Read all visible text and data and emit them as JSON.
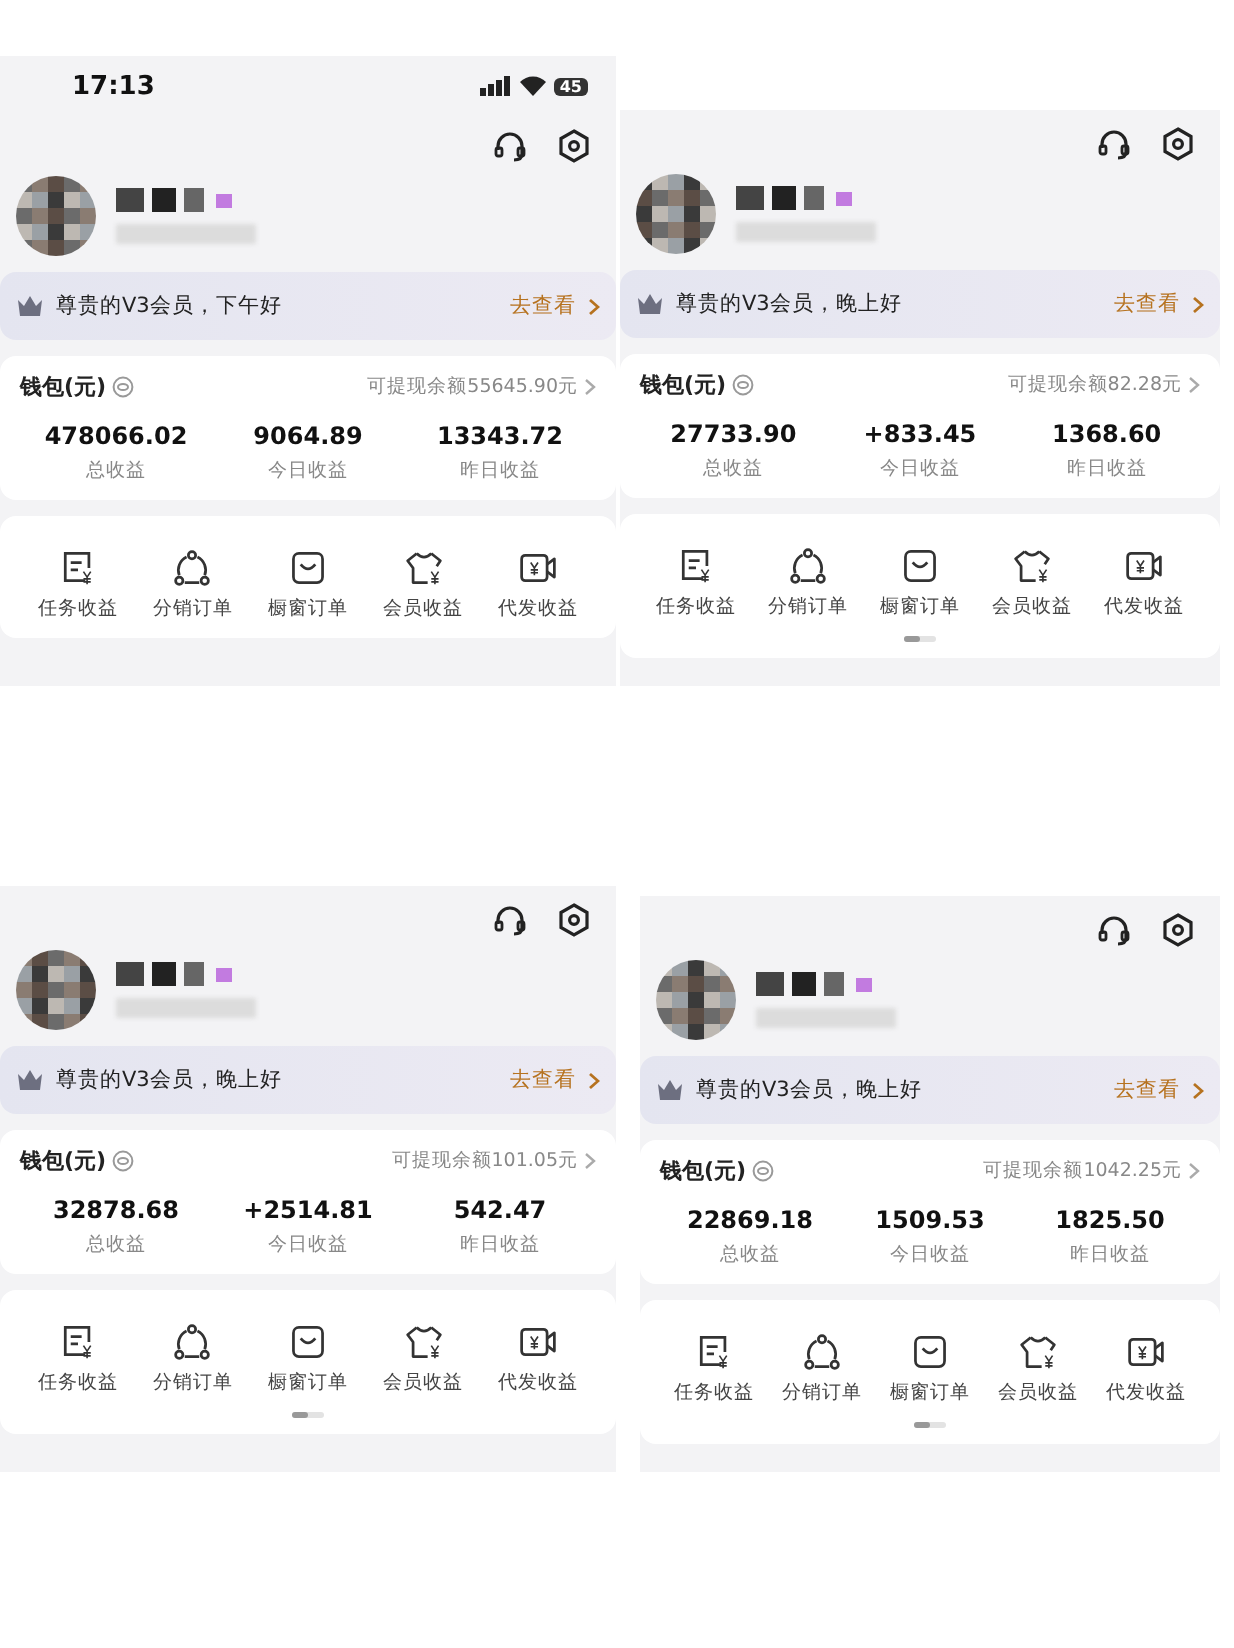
{
  "panels": [
    {
      "status_bar": {
        "time": "17:13",
        "battery": "45"
      },
      "greeting": "尊贵的V3会员，下午好",
      "greeting_link": "去查看",
      "wallet_title": "钱包(元)",
      "withdrawable": "可提现余额55645.90元",
      "stats": [
        {
          "value": "478066.02",
          "label": "总收益"
        },
        {
          "value": "9064.89",
          "label": "今日收益"
        },
        {
          "value": "13343.72",
          "label": "昨日收益"
        }
      ],
      "shortcuts": [
        {
          "kind": "task",
          "label": "任务收益"
        },
        {
          "kind": "share",
          "label": "分销订单"
        },
        {
          "kind": "shop",
          "label": "橱窗订单"
        },
        {
          "kind": "member",
          "label": "会员收益"
        },
        {
          "kind": "video",
          "label": "代发收益"
        }
      ],
      "page_indicator": false
    },
    {
      "greeting": "尊贵的V3会员，晚上好",
      "greeting_link": "去查看",
      "wallet_title": "钱包(元)",
      "withdrawable": "可提现余额82.28元",
      "stats": [
        {
          "value": "27733.90",
          "label": "总收益"
        },
        {
          "value": "+833.45",
          "label": "今日收益"
        },
        {
          "value": "1368.60",
          "label": "昨日收益"
        }
      ],
      "shortcuts": [
        {
          "kind": "task",
          "label": "任务收益"
        },
        {
          "kind": "share",
          "label": "分销订单"
        },
        {
          "kind": "shop",
          "label": "橱窗订单"
        },
        {
          "kind": "member",
          "label": "会员收益"
        },
        {
          "kind": "video",
          "label": "代发收益"
        }
      ],
      "page_indicator": true
    },
    {
      "greeting": "尊贵的V3会员，晚上好",
      "greeting_link": "去查看",
      "wallet_title": "钱包(元)",
      "withdrawable": "可提现余额101.05元",
      "stats": [
        {
          "value": "32878.68",
          "label": "总收益"
        },
        {
          "value": "+2514.81",
          "label": "今日收益"
        },
        {
          "value": "542.47",
          "label": "昨日收益"
        }
      ],
      "shortcuts": [
        {
          "kind": "task",
          "label": "任务收益"
        },
        {
          "kind": "share",
          "label": "分销订单"
        },
        {
          "kind": "shop",
          "label": "橱窗订单"
        },
        {
          "kind": "member",
          "label": "会员收益"
        },
        {
          "kind": "video",
          "label": "代发收益"
        }
      ],
      "page_indicator": true
    },
    {
      "greeting": "尊贵的V3会员，晚上好",
      "greeting_link": "去查看",
      "wallet_title": "钱包(元)",
      "withdrawable": "可提现余额1042.25元",
      "stats": [
        {
          "value": "22869.18",
          "label": "总收益"
        },
        {
          "value": "1509.53",
          "label": "今日收益"
        },
        {
          "value": "1825.50",
          "label": "昨日收益"
        }
      ],
      "shortcuts": [
        {
          "kind": "task",
          "label": "任务收益"
        },
        {
          "kind": "share",
          "label": "分销订单"
        },
        {
          "kind": "shop",
          "label": "橱窗订单"
        },
        {
          "kind": "member",
          "label": "会员收益"
        },
        {
          "kind": "video",
          "label": "代发收益"
        }
      ],
      "page_indicator": true
    }
  ]
}
